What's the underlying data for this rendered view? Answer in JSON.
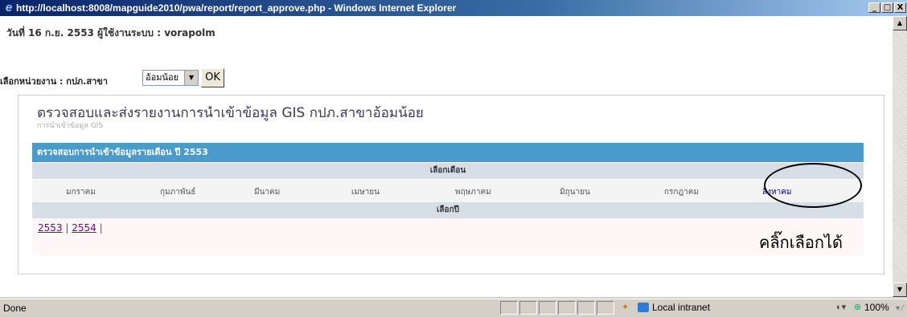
{
  "window": {
    "title": "http://localhost:8008/mapguide2010/pwa/report/report_approve.php - Windows Internet Explorer",
    "minimize": "_",
    "maximize": "□",
    "close": "X"
  },
  "page": {
    "date_user_line": "วันที่ 16 ก.ย. 2553 ผู้ใช้งานระบบ : vorapolm",
    "unit_label": "เลือกหน่วยงาน : กปภ.สาขา",
    "unit_selected": "อ้อมน้อย",
    "ok_label": "OK",
    "heading": "ตรวจสอบและส่งรายงานการนำเข้าข้อมูล GIS กปภ.สาขาอ้อมน้อย",
    "subheading": "การนำเข้าข้อมูล GIS"
  },
  "table": {
    "header": "ตรวจสอบการนำเข้าข้อมูลรายเดือน ปี 2553",
    "month_header": "เลือกเดือน",
    "months": [
      "มกราคม",
      "กุมภาพันธ์",
      "มีนาคม",
      "เมษายน",
      "พฤษภาคม",
      "มิถุนายน",
      "กรกฎาคม",
      "สิงหาคม"
    ],
    "year_header": "เลือกปี",
    "years": [
      "2553",
      "2554"
    ],
    "year_sep": "|"
  },
  "annotation": {
    "text": "คลิ๊กเลือกได้"
  },
  "statusbar": {
    "status": "Done",
    "zone": "Local intranet",
    "zoom": "100%"
  },
  "icons": {
    "browser": "ie-icon",
    "select_arrow": "dropdown-arrow-icon",
    "scroll_up": "scroll-up-icon",
    "scroll_down": "scroll-down-icon",
    "zone": "intranet-icon",
    "zoom": "zoom-icon"
  }
}
